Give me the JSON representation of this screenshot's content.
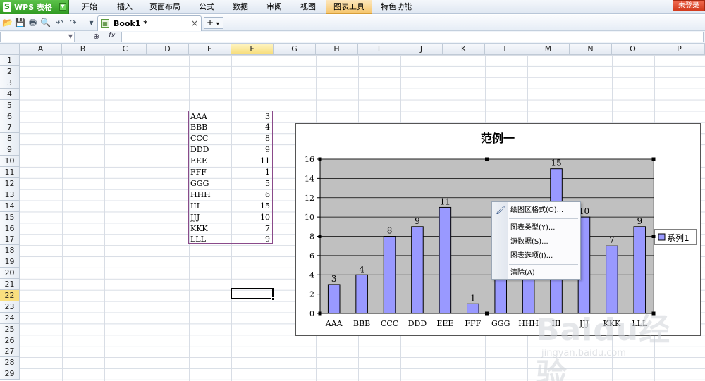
{
  "app": {
    "name": "WPS 表格",
    "logo_glyph": "S"
  },
  "menu": {
    "items": [
      "开始",
      "插入",
      "页面布局",
      "公式",
      "数据",
      "审阅",
      "视图",
      "图表工具",
      "特色功能"
    ],
    "active": "图表工具",
    "login": "未登录"
  },
  "toolbar": {
    "icons": [
      "open-folder-icon",
      "save-icon",
      "print-icon",
      "print-preview-icon",
      "undo-icon",
      "redo-icon",
      "customize-icon"
    ],
    "document_tab": "Book1 *",
    "new_tab_glyph": "+"
  },
  "formula_bar": {
    "name_box": "",
    "fx": "fx",
    "value": ""
  },
  "grid": {
    "columns": [
      "A",
      "B",
      "C",
      "D",
      "E",
      "F",
      "G",
      "H",
      "I",
      "J",
      "K",
      "L",
      "M",
      "N",
      "O",
      "P"
    ],
    "active_column": "F",
    "rows": [
      1,
      2,
      3,
      4,
      5,
      6,
      7,
      8,
      9,
      10,
      11,
      12,
      13,
      14,
      15,
      16,
      17,
      18,
      19,
      20,
      21,
      22,
      23,
      24,
      25,
      26,
      27,
      28,
      29
    ],
    "active_row": 22,
    "table": [
      {
        "label": "AAA",
        "value": 3
      },
      {
        "label": "BBB",
        "value": 4
      },
      {
        "label": "CCC",
        "value": 8
      },
      {
        "label": "DDD",
        "value": 9
      },
      {
        "label": "EEE",
        "value": 11
      },
      {
        "label": "FFF",
        "value": 1
      },
      {
        "label": "GGG",
        "value": 5
      },
      {
        "label": "HHH",
        "value": 6
      },
      {
        "label": "III",
        "value": 15
      },
      {
        "label": "JJJ",
        "value": 10
      },
      {
        "label": "KKK",
        "value": 7
      },
      {
        "label": "LLL",
        "value": 9
      }
    ]
  },
  "chart_data": {
    "type": "bar",
    "title": "范例一",
    "categories": [
      "AAA",
      "BBB",
      "CCC",
      "DDD",
      "EEE",
      "FFF",
      "GGG",
      "HHH",
      "III",
      "JJJ",
      "KKK",
      "LLL"
    ],
    "series": [
      {
        "name": "系列1",
        "values": [
          3,
          4,
          8,
          9,
          11,
          1,
          5,
          6,
          15,
          10,
          7,
          9
        ]
      }
    ],
    "ylim": [
      0,
      16
    ],
    "yticks": [
      0,
      2,
      4,
      6,
      8,
      10,
      12,
      14,
      16
    ],
    "xlabel": "",
    "ylabel": "",
    "grid": true,
    "legend": "right",
    "plot_background": "#c0c0c0",
    "bar_color": "#9999ff"
  },
  "context_menu": {
    "items": [
      {
        "label": "绘图区格式(O)..."
      },
      {
        "label": "图表类型(Y)..."
      },
      {
        "label": "源数据(S)..."
      },
      {
        "label": "图表选项(I)..."
      },
      {
        "label": "清除(A)"
      }
    ]
  },
  "watermark": {
    "brand": "Baidu经验",
    "url": "jingyan.baidu.com"
  }
}
